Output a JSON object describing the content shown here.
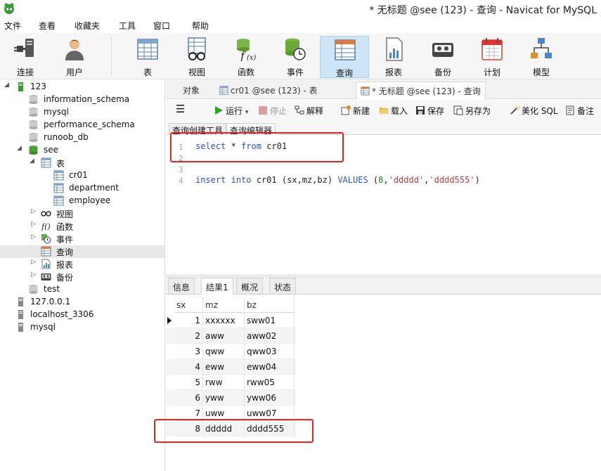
{
  "window": {
    "title": "* 无标题 @see (123) - 查询 - Navicat for MySQL"
  },
  "menu": [
    "文件",
    "查看",
    "收藏夹",
    "工具",
    "窗口",
    "帮助"
  ],
  "toolbar": {
    "connect": "连接",
    "user": "用户",
    "table": "表",
    "view": "视图",
    "function": "函数",
    "event": "事件",
    "query": "查询",
    "report": "报表",
    "backup": "备份",
    "schedule": "计划",
    "model": "模型"
  },
  "tree": {
    "connection": "123",
    "databases": [
      "information_schema",
      "mysql",
      "performance_schema",
      "runoob_db",
      "see"
    ],
    "see_children": {
      "tables": "表",
      "views": "视图",
      "functions": "函数",
      "events": "事件",
      "queries": "查询",
      "reports": "报表",
      "backups": "备份"
    },
    "tables": [
      "cr01",
      "department",
      "employee"
    ],
    "test_db": "test",
    "other_connections": [
      "127.0.0.1",
      "localhost_3306",
      "mysql"
    ]
  },
  "tabs": {
    "objects": "对象",
    "table_tab": "cr01 @see (123) - 表",
    "query_tab": "* 无标题 @see (123) - 查询"
  },
  "query_toolbar": {
    "run": "运行",
    "run_dropdown": "▾",
    "stop": "停止",
    "explain": "解释",
    "new": "新建",
    "load": "载入",
    "save": "保存",
    "save_as": "另存为",
    "beautify": "美化 SQL",
    "note": "备注"
  },
  "sub_tabs": {
    "builder": "查询创建工具",
    "editor": "查询编辑器"
  },
  "editor": {
    "line_numbers": [
      "1",
      "2",
      "3",
      "4"
    ],
    "line1": {
      "kw1": "select",
      "star": " * ",
      "kw2": "from",
      "rest": " cr01"
    },
    "line4": {
      "kw1": "insert",
      "sp1": " ",
      "kw2": "into",
      "mid": " cr01 (sx,mz,bz) ",
      "kw3": "VALUES",
      "open": " (",
      "num": "8",
      "c1": ",",
      "s1": "'ddddd'",
      "c2": ",",
      "s2": "'dddd555'",
      "close": ")"
    }
  },
  "result_tabs": {
    "info": "信息",
    "result1": "结果1",
    "overview": "概况",
    "status": "状态"
  },
  "grid": {
    "headers": [
      "sx",
      "mz",
      "bz"
    ],
    "rows": [
      [
        "1",
        "xxxxxx",
        "sww01"
      ],
      [
        "2",
        "aww",
        "aww02"
      ],
      [
        "3",
        "qww",
        "qww03"
      ],
      [
        "4",
        "eww",
        "eww04"
      ],
      [
        "5",
        "rww",
        "rww05"
      ],
      [
        "6",
        "yww",
        "yww06"
      ],
      [
        "7",
        "uww",
        "uww07"
      ],
      [
        "8",
        "ddddd",
        "dddd555"
      ]
    ]
  },
  "colors": {
    "accent": "#cde6f7",
    "annotation": "#e02424",
    "keyword": "#2b50c8",
    "string": "#b04040",
    "number": "#1d7a1d"
  }
}
